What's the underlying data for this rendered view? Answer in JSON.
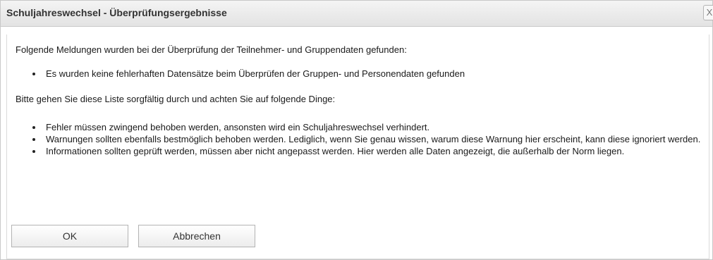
{
  "dialog": {
    "title": "Schuljahreswechsel - Überprüfungsergebnisse",
    "close_label": "X"
  },
  "content": {
    "intro": "Folgende Meldungen wurden bei der Überprüfung der Teilnehmer- und Gruppendaten gefunden:",
    "findings": [
      "Es wurden keine fehlerhaften Datensätze beim Überprüfen der Gruppen- und Personendaten gefunden"
    ],
    "instructions": "Bitte gehen Sie diese Liste sorgfältig durch und achten Sie auf folgende Dinge:",
    "rules": [
      "Fehler müssen zwingend behoben werden, ansonsten wird ein Schuljahreswechsel verhindert.",
      "Warnungen sollten ebenfalls bestmöglich behoben werden. Lediglich, wenn Sie genau wissen, warum diese Warnung hier erscheint, kann diese ignoriert werden.",
      "Informationen sollten geprüft werden, müssen aber nicht angepasst werden. Hier werden alle Daten angezeigt, die außerhalb der Norm liegen."
    ]
  },
  "buttons": {
    "ok": "OK",
    "cancel": "Abbrechen"
  }
}
